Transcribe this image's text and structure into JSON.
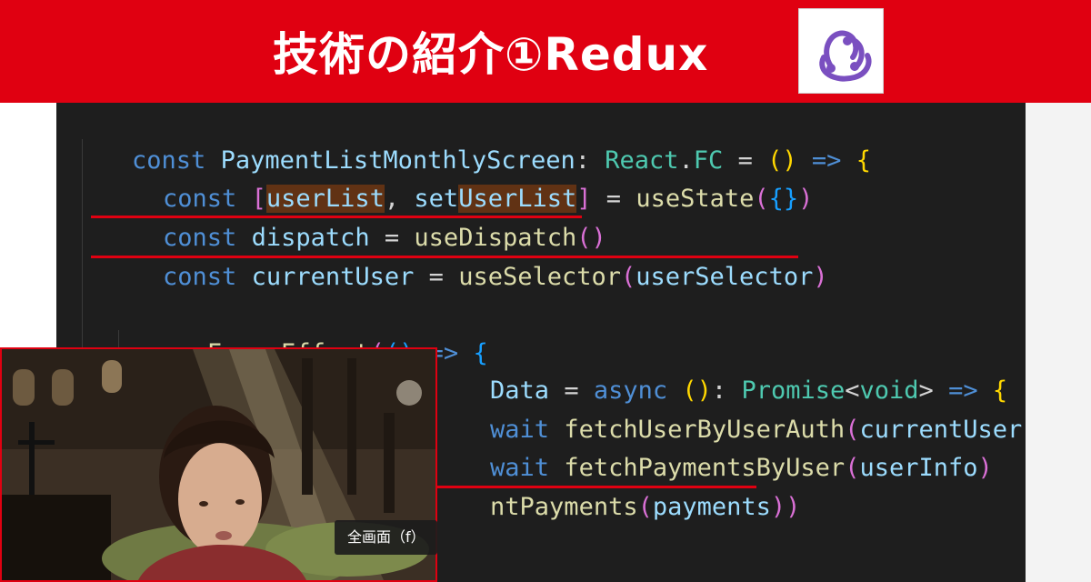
{
  "header": {
    "title": "技術の紹介①Redux",
    "logo_icon": "redux-logo-icon",
    "background_color": "#e00011"
  },
  "code": {
    "line1": {
      "kw": "const",
      "name": "PaymentListMonthlyScreen",
      "colon": ":",
      "type_ns": "React",
      "dot": ".",
      "type_name": "FC",
      "eq": "=",
      "paren_open": "(",
      "paren_close": ")",
      "arrow": "=>",
      "brace": "{"
    },
    "line2": {
      "kw": "const",
      "bracket_open": "[",
      "var1": "userList",
      "comma": ",",
      "var2_prefix": "set",
      "var2_hl": "UserList",
      "bracket_close": "]",
      "eq": "=",
      "fn": "useState",
      "paren_open": "(",
      "obj": "{}",
      "paren_close": ")"
    },
    "line3": {
      "kw": "const",
      "name": "dispatch",
      "eq": "=",
      "fn": "useDispatch",
      "parens": "()"
    },
    "line4": {
      "kw": "const",
      "name": "currentUser",
      "eq": "=",
      "fn": "useSelector",
      "paren_open": "(",
      "arg": "userSelector",
      "paren_close": ")"
    },
    "line5": {
      "fn": "useFocusEffect",
      "paren_open": "(",
      "inner_parens": "()",
      "arrow": "=>",
      "brace": "{"
    },
    "line6": {
      "name": "Data",
      "eq": "=",
      "kw": "async",
      "parens": "()",
      "colon": ":",
      "type": "Promise",
      "lt": "<",
      "generic": "void",
      "gt": ">",
      "arrow": "=>",
      "brace": "{"
    },
    "line7": {
      "kw": "wait",
      "fn": "fetchUserByUserAuth",
      "paren_open": "(",
      "arg": "currentUser",
      "paren_close": ")"
    },
    "line8": {
      "kw": "wait",
      "fn": "fetchPaymentsByUser",
      "paren_open": "(",
      "arg": "userInfo",
      "paren_close": ")"
    },
    "line9": {
      "fn": "ntPayments",
      "paren_open": "(",
      "arg": "payments",
      "paren_close": "))"
    }
  },
  "webcam": {
    "tooltip": "全画面（f）"
  }
}
